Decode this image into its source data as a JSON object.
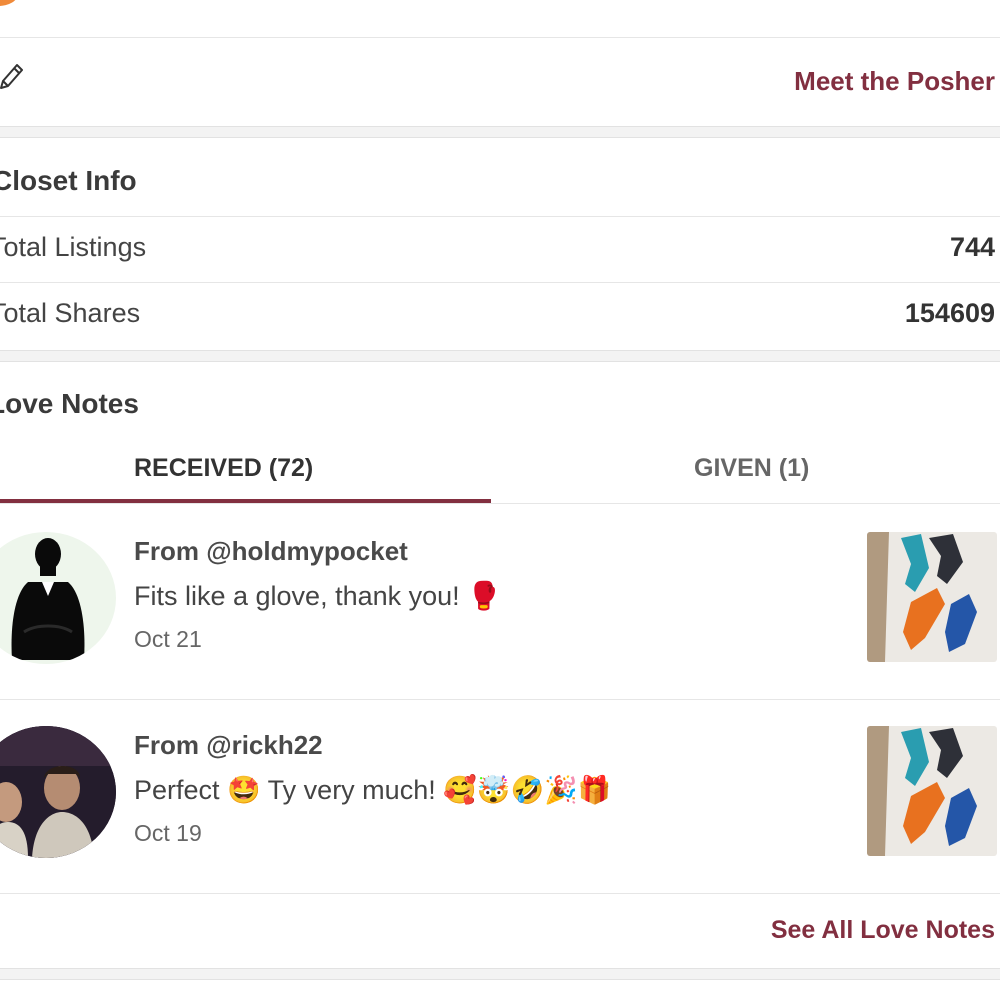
{
  "header": {
    "meet_label": "Meet the Posher"
  },
  "closet_info": {
    "title": "Closet Info",
    "rows": [
      {
        "label": "Total Listings",
        "value": "744"
      },
      {
        "label": "Total Shares",
        "value": "154609"
      }
    ]
  },
  "love_notes": {
    "title": "Love Notes",
    "tabs": [
      {
        "label": "RECEIVED (72)",
        "active": true
      },
      {
        "label": "GIVEN (1)",
        "active": false
      }
    ],
    "items": [
      {
        "from": "From @holdmypocket",
        "message": "Fits like a glove, thank you! 🥊",
        "date": "Oct 21",
        "avatar": "silhouette-avatar"
      },
      {
        "from": "From @rickh22",
        "message": "Perfect 🤩 Ty very much! 🥰🤯🤣🎉🎁",
        "date": "Oct 19",
        "avatar": "photo-avatar"
      }
    ],
    "see_all_label": "See All Love Notes"
  },
  "colors": {
    "accent": "#822f40",
    "text": "#333333",
    "divider": "#e6e6e6"
  }
}
